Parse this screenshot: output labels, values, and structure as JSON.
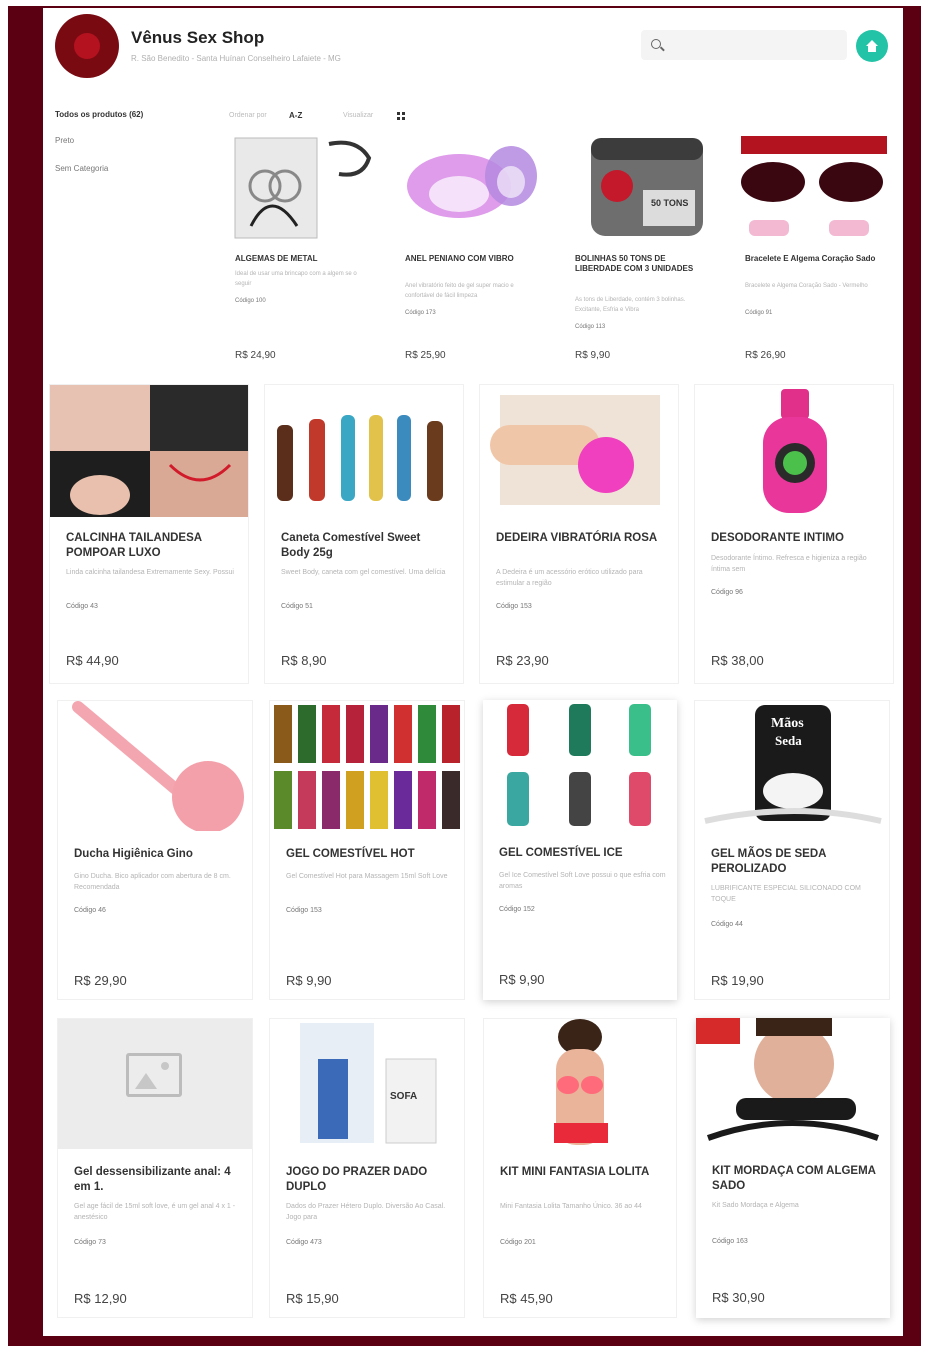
{
  "header": {
    "shop_name": "Vênus Sex Shop",
    "address": "R. São Benedito - Santa Huínan Conselheiro Lafaiete - MG",
    "search_placeholder": ""
  },
  "sidebar": {
    "title": "Todos os produtos (62)",
    "items": [
      {
        "label": "Preto"
      },
      {
        "label": "Sem Categoria"
      }
    ]
  },
  "toolbar": {
    "sort_label": "Ordenar por",
    "sort_value": "A-Z",
    "view_label": "Visualizar"
  },
  "products": [
    {
      "name": "ALGEMAS DE METAL",
      "desc": "Ideal de usar uma brincapo com a algem se o seguir",
      "code": "Código 100",
      "price": "R$ 24,90"
    },
    {
      "name": "ANEL PENIANO COM VIBRO",
      "desc": "Anel vibratório feito de gel super macio e confortável de fácil limpeza",
      "code": "Código 173",
      "price": "R$ 25,90"
    },
    {
      "name": "BOLINHAS 50 TONS DE LIBERDADE COM 3 UNIDADES",
      "desc": "As tons de Liberdade, contém 3 bolinhas. Excitante, Esfria e Vibra",
      "code": "Código 113",
      "price": "R$ 9,90"
    },
    {
      "name": "Bracelete E Algema Coração Sado",
      "desc": "Bracelete e Algema Coração Sado - Vermelho",
      "code": "Código 91",
      "price": "R$ 26,90"
    },
    {
      "name": "CALCINHA TAILANDESA POMPOAR LUXO",
      "desc": "Linda calcinha tailandesa Extremamente Sexy. Possui",
      "code": "Código 43",
      "price": "R$ 44,90"
    },
    {
      "name": "Caneta Comestível Sweet Body 25g",
      "desc": "Sweet Body, caneta com gel comestível. Uma delícia",
      "code": "Código 51",
      "price": "R$ 8,90"
    },
    {
      "name": "DEDEIRA VIBRATÓRIA ROSA",
      "desc": "A Dedeira é um acessório erótico utilizado para estimular a região",
      "code": "Código 153",
      "price": "R$ 23,90"
    },
    {
      "name": "DESODORANTE INTIMO",
      "desc": "Desodorante Íntimo. Refresca e higieniza a região íntima sem",
      "code": "Código 96",
      "price": "R$ 38,00"
    },
    {
      "name": "Ducha Higiênica Gino",
      "desc": "Gino Ducha. Bico aplicador com abertura de 8 cm. Recomendada",
      "code": "Código 46",
      "price": "R$ 29,90"
    },
    {
      "name": "GEL COMESTÍVEL HOT",
      "desc": "Gel Comestível Hot para Massagem 15ml Soft Love",
      "code": "Código 153",
      "price": "R$ 9,90"
    },
    {
      "name": "GEL COMESTÍVEL ICE",
      "desc": "Gel Ice Comestível Soft Love possui o que esfria com aromas",
      "code": "Código 152",
      "price": "R$ 9,90"
    },
    {
      "name": "GEL MÃOS DE SEDA PEROLIZADO",
      "desc": "LUBRIFICANTE ESPECIAL SILICONADO COM TOQUE",
      "code": "Código 44",
      "price": "R$ 19,90"
    },
    {
      "name": "Gel dessensibilizante anal: 4 em 1.",
      "desc": "Gel age fácil de 15ml soft love, é um gel anal 4 x 1 - anestésico",
      "code": "Código 73",
      "price": "R$ 12,90"
    },
    {
      "name": "JOGO DO PRAZER DADO DUPLO",
      "desc": "Dados do Prazer Hétero Duplo. Diversão Ao Casal. Jogo para",
      "code": "Código 473",
      "price": "R$ 15,90"
    },
    {
      "name": "KIT MINI FANTASIA LOLITA",
      "desc": "Mini Fantasia Lolita Tamanho Único. 36 ao 44",
      "code": "Código 201",
      "price": "R$ 45,90"
    },
    {
      "name": "KIT MORDAÇA COM ALGEMA SADO",
      "desc": "Kit Sado Mordaça e Algema",
      "code": "Código 163",
      "price": "R$ 30,90"
    }
  ],
  "colors": {
    "frame": "#5b0013",
    "accent": "#22c3a6",
    "logo": "#7a0a12"
  }
}
